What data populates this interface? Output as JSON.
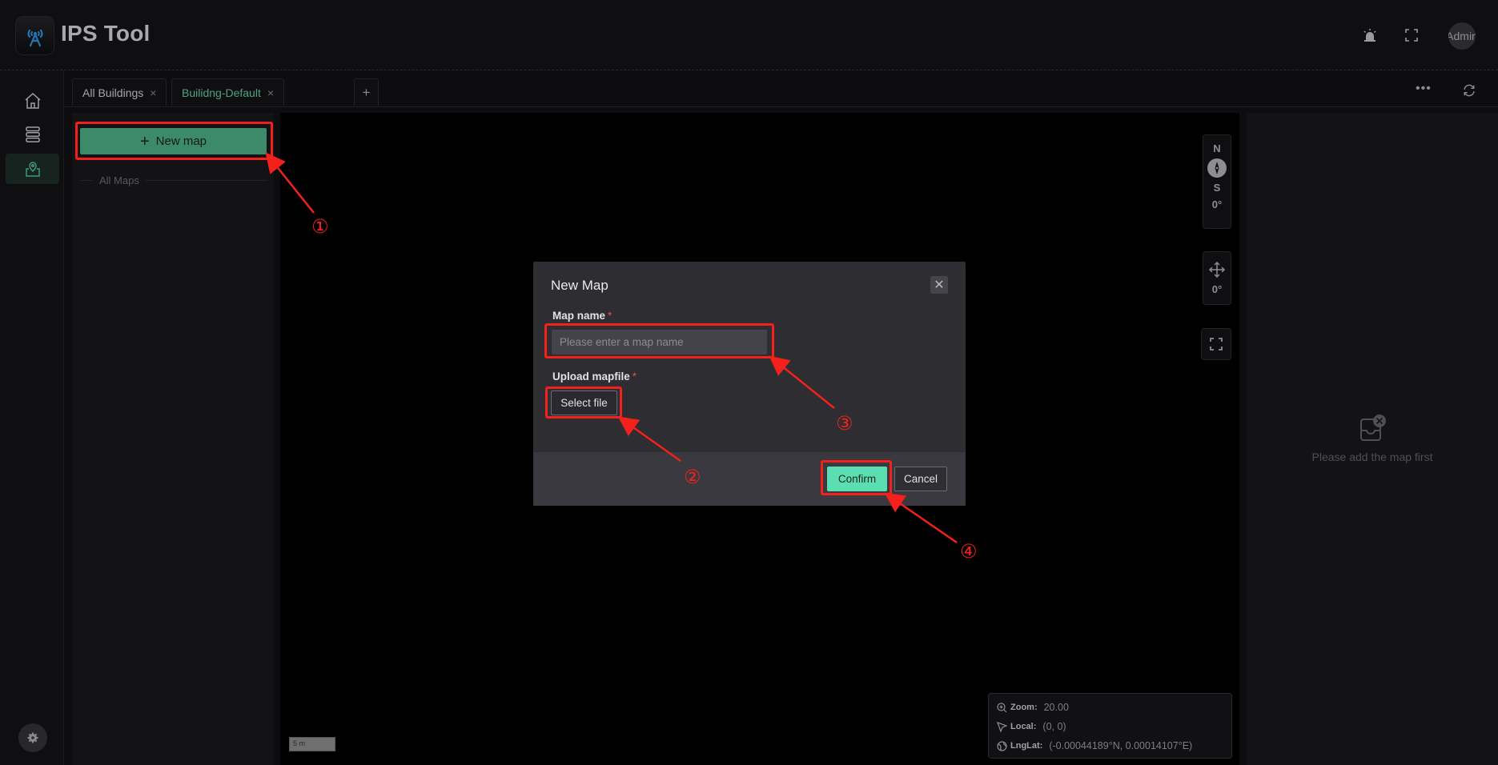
{
  "app": {
    "title": "IPS Tool",
    "user_avatar_label": "Admin",
    "header_icons": [
      "alarm-icon",
      "fullscreen-icon"
    ]
  },
  "sidenav": {
    "items": [
      {
        "name": "home",
        "icon": "home-icon",
        "active": false
      },
      {
        "name": "list",
        "icon": "server-list-icon",
        "active": false
      },
      {
        "name": "map",
        "icon": "map-pin-icon",
        "active": true
      }
    ],
    "settings_icon": "gear-icon"
  },
  "tabs": [
    {
      "label": "All Buildings",
      "active": false,
      "closable": true
    },
    {
      "label": "Builidng-Default",
      "active": true,
      "closable": true
    }
  ],
  "tab_add_label": "+",
  "tab_close_glyph": "×",
  "tab_actions": {
    "more_label": "•••",
    "refresh_icon": "refresh-icon"
  },
  "left_panel": {
    "new_map_label": "New map",
    "new_map_icon": "+",
    "all_maps_label": "All Maps"
  },
  "map": {
    "compass": {
      "north": "N",
      "south": "S",
      "rotation": "0°"
    },
    "pan": {
      "tilt": "0°"
    },
    "scale_label": "5 m",
    "info": {
      "zoom_key": "Zoom:",
      "zoom_value": "20.00",
      "local_key": "Local:",
      "local_value": "(0,  0)",
      "lnglat_key": "LngLat:",
      "lnglat_value": "(-0.00044189°N,  0.00014107°E)"
    }
  },
  "right_panel": {
    "empty_text": "Please add the map first"
  },
  "dialog": {
    "title": "New Map",
    "close_glyph": "✕",
    "map_name_label": "Map name",
    "map_name_placeholder": "Please enter a map name",
    "map_name_value": "",
    "upload_label": "Upload mapfile",
    "required_mark": "*",
    "select_file_label": "Select file",
    "confirm_label": "Confirm",
    "cancel_label": "Cancel"
  },
  "annotations": {
    "color": "#f3201c",
    "steps": [
      "①",
      "②",
      "③",
      "④"
    ]
  }
}
